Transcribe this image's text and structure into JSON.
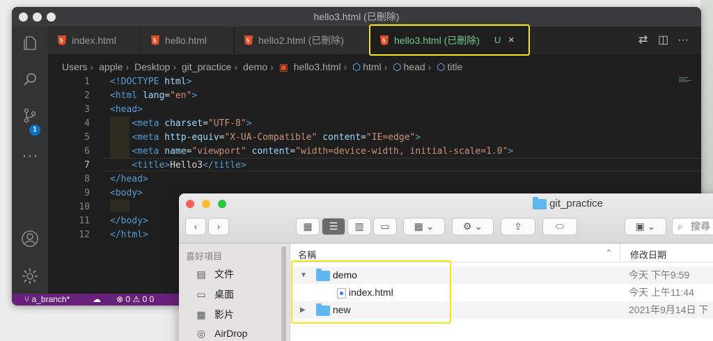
{
  "vscode": {
    "window_title": "hello3.html (已刪除)",
    "tabs": [
      {
        "label": "index.html"
      },
      {
        "label": "hello.html"
      },
      {
        "label": "hello2.html (已刪除)"
      },
      {
        "label": "hello3.html (已刪除)",
        "mark": "U",
        "close": "×"
      }
    ],
    "breadcrumb": [
      "Users",
      "apple",
      "Desktop",
      "git_practice",
      "demo",
      "hello3.html",
      "html",
      "head",
      "title"
    ],
    "scm_badge": "1",
    "line_numbers": [
      "1",
      "2",
      "3",
      "4",
      "5",
      "6",
      "7",
      "8",
      "9",
      "10",
      "11",
      "12"
    ],
    "code": {
      "l1_doctype": "<!DOCTYPE",
      "l1_html": "html",
      "l1_close": ">",
      "l2_open": "<html",
      "l2_attr": "lang",
      "l2_eq": "=",
      "l2_val": "\"en\"",
      "l2_close": ">",
      "l3": "<head>",
      "l4_tag": "<meta",
      "l4_attr": "charset",
      "l4_eq": "=",
      "l4_val": "\"UTF-8\"",
      "l4_close": ">",
      "l5_tag": "<meta",
      "l5_attr1": "http-equiv",
      "l5_val1": "\"X-UA-Compatible\"",
      "l5_attr2": "content",
      "l5_val2": "\"IE=edge\"",
      "l5_close": ">",
      "l6_tag": "<meta",
      "l6_attr1": "name",
      "l6_val1": "\"viewport\"",
      "l6_attr2": "content",
      "l6_val2": "\"width=device-width, initial-scale=1.0\"",
      "l6_close": ">",
      "l7_open": "<title>",
      "l7_text": "Hello3",
      "l7_close": "</title>",
      "l8": "</head>",
      "l9": "<body>",
      "l11": "</body>",
      "l12": "</html>"
    },
    "status": {
      "branch": "a_branch*",
      "errors": "0",
      "warnings": "0",
      "extra": "0"
    }
  },
  "finder": {
    "title": "git_practice",
    "search_placeholder": "搜尋",
    "sidebar": {
      "heading": "喜好項目",
      "items": [
        {
          "label": "文件",
          "icon": "document-icon"
        },
        {
          "label": "桌面",
          "icon": "desktop-icon"
        },
        {
          "label": "影片",
          "icon": "film-icon"
        },
        {
          "label": "AirDrop",
          "icon": "airdrop-icon"
        }
      ]
    },
    "columns": {
      "name": "名稱",
      "modified": "修改日期"
    },
    "rows": [
      {
        "name": "demo",
        "type": "folder",
        "expanded": true,
        "date": "今天 下午9:59"
      },
      {
        "name": "index.html",
        "type": "file",
        "date": "今天 上午11:44"
      },
      {
        "name": "new",
        "type": "folder",
        "expanded": false,
        "date": "2021年9月14日 下"
      }
    ]
  }
}
